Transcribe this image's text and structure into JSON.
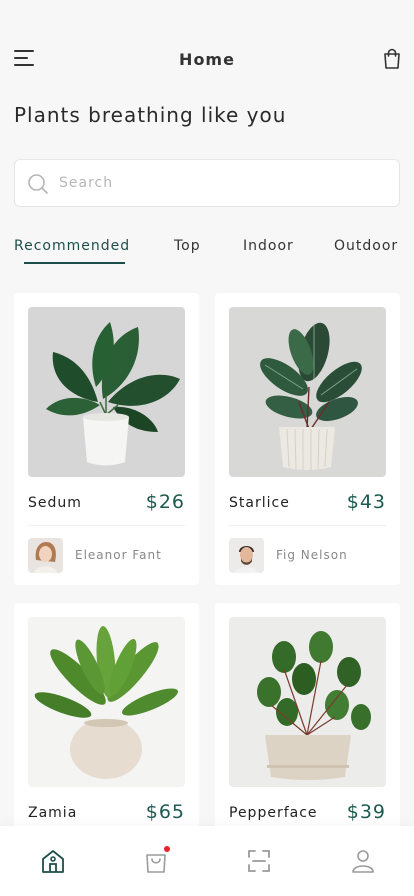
{
  "header": {
    "title": "Home",
    "menu_icon": "menu-icon",
    "cart_icon": "cart-icon"
  },
  "headline": "Plants breathing like you",
  "search": {
    "placeholder": "Search",
    "value": "",
    "icon": "search-icon"
  },
  "tabs": [
    {
      "label": "Recommended",
      "active": true
    },
    {
      "label": "Top",
      "active": false
    },
    {
      "label": "Indoor",
      "active": false
    },
    {
      "label": "Outdoor",
      "active": false
    }
  ],
  "products": [
    {
      "name": "Sedum",
      "price": "$26",
      "owner": "Eleanor Fant",
      "plant": "monstera"
    },
    {
      "name": "Starlice",
      "price": "$43",
      "owner": "Fig Nelson",
      "plant": "calathea"
    },
    {
      "name": "Zamia",
      "price": "$65",
      "owner": "",
      "plant": "fern"
    },
    {
      "name": "Pepperface",
      "price": "$39",
      "owner": "",
      "plant": "peperomia"
    }
  ],
  "bottom_nav": [
    {
      "icon": "home-icon",
      "active": true
    },
    {
      "icon": "shopping-bag-icon",
      "active": false,
      "badge": true
    },
    {
      "icon": "scan-icon",
      "active": false
    },
    {
      "icon": "profile-icon",
      "active": false
    }
  ],
  "colors": {
    "accent": "#1d4f4a",
    "price": "#1d5a50",
    "badge": "#e8212b",
    "background": "#f7f7f7"
  }
}
